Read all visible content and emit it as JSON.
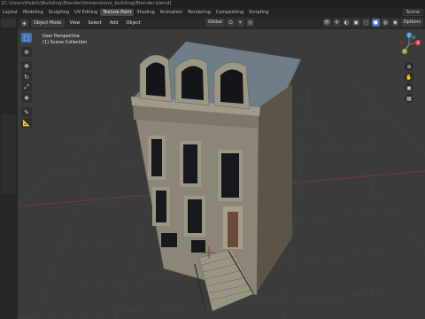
{
  "app": {
    "title": "[C:\\Users\\Public\\Building\\Blender\\brownstone_building\\Blender.blend]"
  },
  "workspaces": [
    "Layout",
    "Modeling",
    "Sculpting",
    "UV Editing",
    "Texture Paint",
    "Shading",
    "Animation",
    "Rendering",
    "Compositing",
    "Scripting"
  ],
  "active_workspace": "Texture Paint",
  "topbar_right": {
    "scene_label": "Scene",
    "options_label": "Options"
  },
  "viewport_header": {
    "mode": "Object Mode",
    "menus": [
      "View",
      "Select",
      "Add",
      "Object"
    ],
    "transform_orientation": "Global"
  },
  "viewport_info": {
    "line1": "User Perspective",
    "line2": "(1) Scene Collection"
  },
  "toolbar_icons": [
    "select-box-icon",
    "cursor-icon",
    "move-icon",
    "rotate-icon",
    "scale-icon",
    "transform-icon",
    "annotate-icon",
    "measure-icon"
  ],
  "nav_axes": {
    "x": "X",
    "y": "Y",
    "z": "Z"
  },
  "colors": {
    "accent": "#4772b3",
    "viewport_bg": "#3b3b3b",
    "stone": "#8b8677",
    "roof": "#6f7d86",
    "axis_x": "#c8444a",
    "axis_y": "#7ea233",
    "axis_z": "#3f7ee0"
  }
}
